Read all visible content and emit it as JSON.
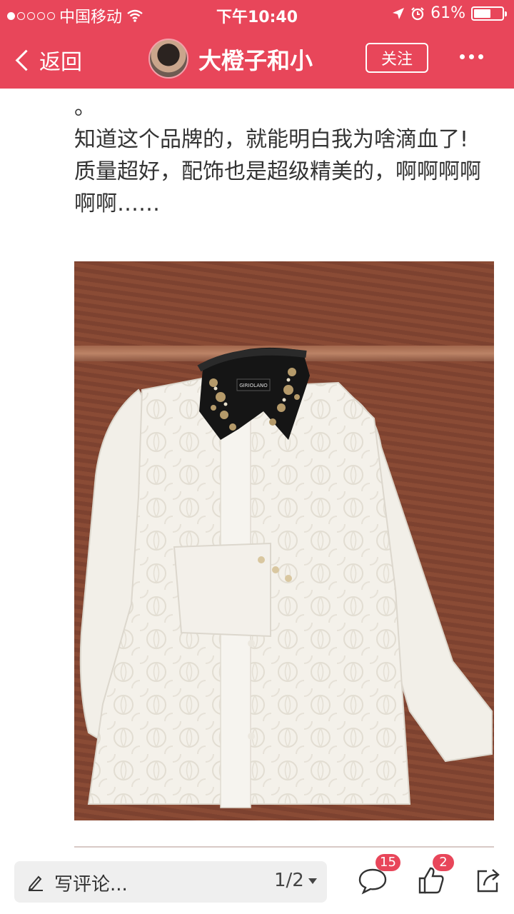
{
  "status_bar": {
    "carrier": "中国移动",
    "time": "下午10:40",
    "battery": "61%",
    "battery_level": 0.61
  },
  "nav": {
    "back_label": "返回",
    "title": "大橙子和小",
    "follow_label": "关注"
  },
  "article": {
    "lines": [
      "。",
      "知道这个品牌的，就能明白我为啥滴血了!",
      "质量超好，配饰也是超级精美的，啊啊啊啊",
      "啊啊……"
    ]
  },
  "photo": {
    "label_text": "GIRIOLANO"
  },
  "bottom_bar": {
    "comment_placeholder": "写评论...",
    "page_indicator": "1/2",
    "comments_count": "15",
    "likes_count": "2"
  },
  "colors": {
    "brand_red": "#e8465a"
  },
  "icons": [
    "wifi-icon",
    "location-arrow-icon",
    "alarm-icon",
    "battery-icon",
    "chevron-left-icon",
    "more-icon",
    "pen-icon",
    "comment-icon",
    "thumbs-up-icon",
    "share-icon"
  ]
}
